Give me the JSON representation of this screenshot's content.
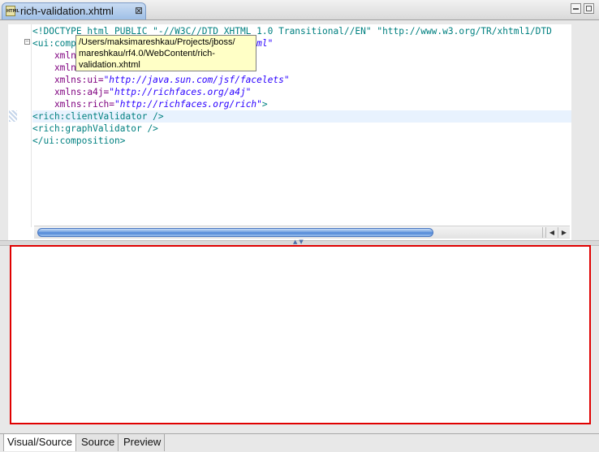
{
  "editor_tab": {
    "icon": "html-file-icon",
    "icon_text": "HTML",
    "title": "rich-validation.xhtml",
    "close_glyph": "⊠"
  },
  "code_lines": [
    [
      {
        "c": "doctype",
        "t": "<!DOCTYPE html PUBLIC \"-//W3C//DTD XHTML 1.0 Transitional//EN\" \"http://www.w3.org/TR/xhtml1/DTD"
      }
    ],
    [
      {
        "c": "tag",
        "t": "<ui:comp"
      },
      {
        "c": "attr",
        "t": "                        "
      },
      {
        "c": "val",
        "t": "/1999/xhtml\""
      }
    ],
    [
      {
        "c": "attr",
        "t": "    xmln"
      },
      {
        "c": "attr",
        "t": "                             "
      },
      {
        "c": "val",
        "t": "l\""
      }
    ],
    [
      {
        "c": "attr",
        "t": "    xmln"
      },
      {
        "c": "attr",
        "t": "                             "
      },
      {
        "c": "val",
        "t": "e\""
      }
    ],
    [
      {
        "c": "attr",
        "t": "    xmlns:ui="
      },
      {
        "c": "val",
        "t": "\"http://java.sun.com/jsf/facelets\""
      }
    ],
    [
      {
        "c": "attr",
        "t": "    xmlns:a4j="
      },
      {
        "c": "val",
        "t": "\"http://richfaces.org/a4j\""
      }
    ],
    [
      {
        "c": "attr",
        "t": "    xmlns:rich="
      },
      {
        "c": "val",
        "t": "\"http://richfaces.org/rich\""
      },
      {
        "c": "punc",
        "t": ">"
      }
    ],
    [
      {
        "c": "tag",
        "t": "<rich:clientValidator />"
      }
    ],
    [
      {
        "c": "tag",
        "t": "<rich:graphValidator />"
      }
    ],
    [
      {
        "c": "tag",
        "t": "</ui:composition>"
      }
    ]
  ],
  "highlighted_line": 7,
  "tooltip": {
    "lines": [
      "/Users/maksimareshkau/Projects/jboss/",
      "mareshkau/rf4.0/WebContent/rich-",
      "validation.xhtml"
    ]
  },
  "scrollbar": {
    "left_arrow": "◀",
    "right_arrow": "▶"
  },
  "sash_arrows": "▲▼",
  "bottom_tabs": [
    {
      "label": "Visual/Source",
      "active": true
    },
    {
      "label": "Source",
      "active": false
    },
    {
      "label": "Preview",
      "active": false
    }
  ]
}
